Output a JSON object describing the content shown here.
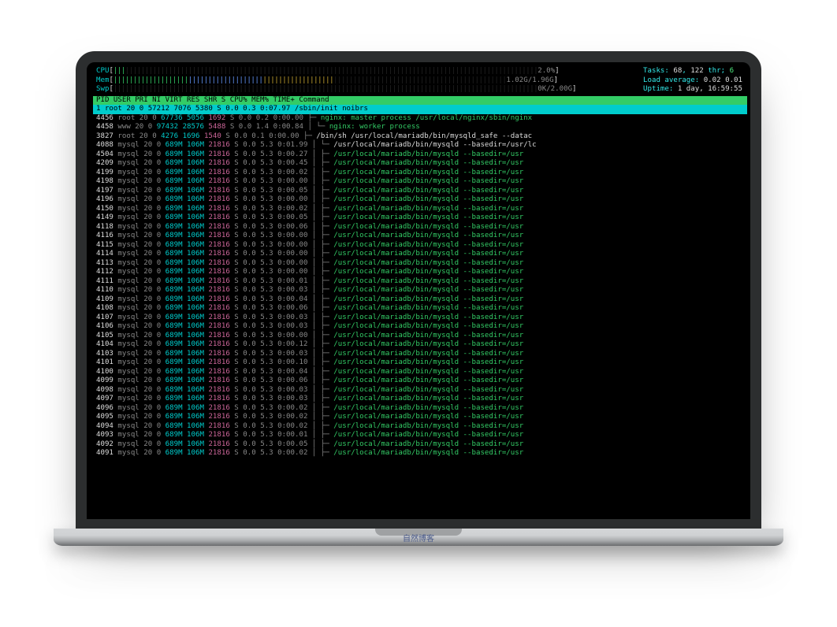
{
  "cpu": {
    "label": "CPU",
    "pct": "2.0%"
  },
  "mem": {
    "label": "Mem",
    "used": "1.02G",
    "total": "1.96G"
  },
  "swp": {
    "label": "Swp",
    "used": "0K",
    "total": "2.00G"
  },
  "info": {
    "tasks_lbl": "Tasks:",
    "tasks": "68",
    "tasks_thr": "122",
    "thr_lbl": "thr;",
    "running": "6",
    "load_lbl": "Load average:",
    "load1": "0.02",
    "load2": "0.01",
    "uptime_lbl": "Uptime:",
    "uptime": "1 day, 16:59:55"
  },
  "columns": {
    "pid": "PID",
    "user": "USER",
    "pri": "PRI",
    "ni": "NI",
    "virt": "VIRT",
    "res": "RES",
    "shr": "SHR",
    "s": "S",
    "cpu": "CPU%",
    "mem": "MEM%",
    "time": "TIME+",
    "cmd": "Command"
  },
  "selected": {
    "pid": "1",
    "user": "root",
    "pri": "20",
    "ni": "0",
    "virt": "57212",
    "res": "7076",
    "shr": "5380",
    "s": "S",
    "cpu": "0.0",
    "mem": "0.3",
    "time": "0:07.97",
    "cmd": "/sbin/init noibrs"
  },
  "rows": [
    {
      "pid": "4456",
      "user": "root",
      "pri": "20",
      "ni": "0",
      "virt": "67736",
      "res": "5056",
      "shr": "1692",
      "s": "S",
      "cpu": "0.0",
      "mem": "0.2",
      "time": "0:00.00",
      "tree": "├─ ",
      "cmd": "nginx: master process /usr/local/nginx/sbin/nginx",
      "cmdcls": "c-green"
    },
    {
      "pid": "4458",
      "user": "www",
      "pri": "20",
      "ni": "0",
      "virt": "97432",
      "res": "28576",
      "shr": "5488",
      "s": "S",
      "cpu": "0.0",
      "mem": "1.4",
      "time": "0:00.84",
      "tree": "│  └─ ",
      "cmd": "nginx: worker process",
      "cmdcls": "c-green"
    },
    {
      "pid": "3827",
      "user": "root",
      "pri": "20",
      "ni": "0",
      "virt": "4276",
      "res": "1696",
      "shr": "1540",
      "s": "S",
      "cpu": "0.0",
      "mem": "0.1",
      "time": "0:00.00",
      "tree": "├─ ",
      "cmd": "/bin/sh /usr/local/mariadb/bin/mysqld_safe --datac",
      "cmdcls": "c-white"
    },
    {
      "pid": "4088",
      "user": "mysql",
      "pri": "20",
      "ni": "0",
      "virt": "689M",
      "res": "106M",
      "shr": "21816",
      "s": "S",
      "cpu": "0.0",
      "mem": "5.3",
      "time": "0:01.99",
      "tree": "│  └─ ",
      "cmd": "/usr/local/mariadb/bin/mysqld --basedir=/usr/lc",
      "cmdcls": "c-white"
    },
    {
      "pid": "4504",
      "user": "mysql",
      "pri": "20",
      "ni": "0",
      "virt": "689M",
      "res": "106M",
      "shr": "21816",
      "s": "S",
      "cpu": "0.0",
      "mem": "5.3",
      "time": "0:00.27",
      "tree": "│     ├─ ",
      "cmd": "/usr/local/mariadb/bin/mysqld --basedir=/usr",
      "cmdcls": "c-green"
    },
    {
      "pid": "4209",
      "user": "mysql",
      "pri": "20",
      "ni": "0",
      "virt": "689M",
      "res": "106M",
      "shr": "21816",
      "s": "S",
      "cpu": "0.0",
      "mem": "5.3",
      "time": "0:00.45",
      "tree": "│     ├─ ",
      "cmd": "/usr/local/mariadb/bin/mysqld --basedir=/usr",
      "cmdcls": "c-green"
    },
    {
      "pid": "4199",
      "user": "mysql",
      "pri": "20",
      "ni": "0",
      "virt": "689M",
      "res": "106M",
      "shr": "21816",
      "s": "S",
      "cpu": "0.0",
      "mem": "5.3",
      "time": "0:00.02",
      "tree": "│     ├─ ",
      "cmd": "/usr/local/mariadb/bin/mysqld --basedir=/usr",
      "cmdcls": "c-green"
    },
    {
      "pid": "4198",
      "user": "mysql",
      "pri": "20",
      "ni": "0",
      "virt": "689M",
      "res": "106M",
      "shr": "21816",
      "s": "S",
      "cpu": "0.0",
      "mem": "5.3",
      "time": "0:00.00",
      "tree": "│     ├─ ",
      "cmd": "/usr/local/mariadb/bin/mysqld --basedir=/usr",
      "cmdcls": "c-green"
    },
    {
      "pid": "4197",
      "user": "mysql",
      "pri": "20",
      "ni": "0",
      "virt": "689M",
      "res": "106M",
      "shr": "21816",
      "s": "S",
      "cpu": "0.0",
      "mem": "5.3",
      "time": "0:00.05",
      "tree": "│     ├─ ",
      "cmd": "/usr/local/mariadb/bin/mysqld --basedir=/usr",
      "cmdcls": "c-green"
    },
    {
      "pid": "4196",
      "user": "mysql",
      "pri": "20",
      "ni": "0",
      "virt": "689M",
      "res": "106M",
      "shr": "21816",
      "s": "S",
      "cpu": "0.0",
      "mem": "5.3",
      "time": "0:00.00",
      "tree": "│     ├─ ",
      "cmd": "/usr/local/mariadb/bin/mysqld --basedir=/usr",
      "cmdcls": "c-green"
    },
    {
      "pid": "4150",
      "user": "mysql",
      "pri": "20",
      "ni": "0",
      "virt": "689M",
      "res": "106M",
      "shr": "21816",
      "s": "S",
      "cpu": "0.0",
      "mem": "5.3",
      "time": "0:00.02",
      "tree": "│     ├─ ",
      "cmd": "/usr/local/mariadb/bin/mysqld --basedir=/usr",
      "cmdcls": "c-green"
    },
    {
      "pid": "4149",
      "user": "mysql",
      "pri": "20",
      "ni": "0",
      "virt": "689M",
      "res": "106M",
      "shr": "21816",
      "s": "S",
      "cpu": "0.0",
      "mem": "5.3",
      "time": "0:00.05",
      "tree": "│     ├─ ",
      "cmd": "/usr/local/mariadb/bin/mysqld --basedir=/usr",
      "cmdcls": "c-green"
    },
    {
      "pid": "4118",
      "user": "mysql",
      "pri": "20",
      "ni": "0",
      "virt": "689M",
      "res": "106M",
      "shr": "21816",
      "s": "S",
      "cpu": "0.0",
      "mem": "5.3",
      "time": "0:00.06",
      "tree": "│     ├─ ",
      "cmd": "/usr/local/mariadb/bin/mysqld --basedir=/usr",
      "cmdcls": "c-green"
    },
    {
      "pid": "4116",
      "user": "mysql",
      "pri": "20",
      "ni": "0",
      "virt": "689M",
      "res": "106M",
      "shr": "21816",
      "s": "S",
      "cpu": "0.0",
      "mem": "5.3",
      "time": "0:00.00",
      "tree": "│     ├─ ",
      "cmd": "/usr/local/mariadb/bin/mysqld --basedir=/usr",
      "cmdcls": "c-green"
    },
    {
      "pid": "4115",
      "user": "mysql",
      "pri": "20",
      "ni": "0",
      "virt": "689M",
      "res": "106M",
      "shr": "21816",
      "s": "S",
      "cpu": "0.0",
      "mem": "5.3",
      "time": "0:00.00",
      "tree": "│     ├─ ",
      "cmd": "/usr/local/mariadb/bin/mysqld --basedir=/usr",
      "cmdcls": "c-green"
    },
    {
      "pid": "4114",
      "user": "mysql",
      "pri": "20",
      "ni": "0",
      "virt": "689M",
      "res": "106M",
      "shr": "21816",
      "s": "S",
      "cpu": "0.0",
      "mem": "5.3",
      "time": "0:00.00",
      "tree": "│     ├─ ",
      "cmd": "/usr/local/mariadb/bin/mysqld --basedir=/usr",
      "cmdcls": "c-green"
    },
    {
      "pid": "4113",
      "user": "mysql",
      "pri": "20",
      "ni": "0",
      "virt": "689M",
      "res": "106M",
      "shr": "21816",
      "s": "S",
      "cpu": "0.0",
      "mem": "5.3",
      "time": "0:00.00",
      "tree": "│     ├─ ",
      "cmd": "/usr/local/mariadb/bin/mysqld --basedir=/usr",
      "cmdcls": "c-green"
    },
    {
      "pid": "4112",
      "user": "mysql",
      "pri": "20",
      "ni": "0",
      "virt": "689M",
      "res": "106M",
      "shr": "21816",
      "s": "S",
      "cpu": "0.0",
      "mem": "5.3",
      "time": "0:00.00",
      "tree": "│     ├─ ",
      "cmd": "/usr/local/mariadb/bin/mysqld --basedir=/usr",
      "cmdcls": "c-green"
    },
    {
      "pid": "4111",
      "user": "mysql",
      "pri": "20",
      "ni": "0",
      "virt": "689M",
      "res": "106M",
      "shr": "21816",
      "s": "S",
      "cpu": "0.0",
      "mem": "5.3",
      "time": "0:00.01",
      "tree": "│     ├─ ",
      "cmd": "/usr/local/mariadb/bin/mysqld --basedir=/usr",
      "cmdcls": "c-green"
    },
    {
      "pid": "4110",
      "user": "mysql",
      "pri": "20",
      "ni": "0",
      "virt": "689M",
      "res": "106M",
      "shr": "21816",
      "s": "S",
      "cpu": "0.0",
      "mem": "5.3",
      "time": "0:00.03",
      "tree": "│     ├─ ",
      "cmd": "/usr/local/mariadb/bin/mysqld --basedir=/usr",
      "cmdcls": "c-green"
    },
    {
      "pid": "4109",
      "user": "mysql",
      "pri": "20",
      "ni": "0",
      "virt": "689M",
      "res": "106M",
      "shr": "21816",
      "s": "S",
      "cpu": "0.0",
      "mem": "5.3",
      "time": "0:00.04",
      "tree": "│     ├─ ",
      "cmd": "/usr/local/mariadb/bin/mysqld --basedir=/usr",
      "cmdcls": "c-green"
    },
    {
      "pid": "4108",
      "user": "mysql",
      "pri": "20",
      "ni": "0",
      "virt": "689M",
      "res": "106M",
      "shr": "21816",
      "s": "S",
      "cpu": "0.0",
      "mem": "5.3",
      "time": "0:00.06",
      "tree": "│     ├─ ",
      "cmd": "/usr/local/mariadb/bin/mysqld --basedir=/usr",
      "cmdcls": "c-green"
    },
    {
      "pid": "4107",
      "user": "mysql",
      "pri": "20",
      "ni": "0",
      "virt": "689M",
      "res": "106M",
      "shr": "21816",
      "s": "S",
      "cpu": "0.0",
      "mem": "5.3",
      "time": "0:00.03",
      "tree": "│     ├─ ",
      "cmd": "/usr/local/mariadb/bin/mysqld --basedir=/usr",
      "cmdcls": "c-green"
    },
    {
      "pid": "4106",
      "user": "mysql",
      "pri": "20",
      "ni": "0",
      "virt": "689M",
      "res": "106M",
      "shr": "21816",
      "s": "S",
      "cpu": "0.0",
      "mem": "5.3",
      "time": "0:00.03",
      "tree": "│     ├─ ",
      "cmd": "/usr/local/mariadb/bin/mysqld --basedir=/usr",
      "cmdcls": "c-green"
    },
    {
      "pid": "4105",
      "user": "mysql",
      "pri": "20",
      "ni": "0",
      "virt": "689M",
      "res": "106M",
      "shr": "21816",
      "s": "S",
      "cpu": "0.0",
      "mem": "5.3",
      "time": "0:00.00",
      "tree": "│     ├─ ",
      "cmd": "/usr/local/mariadb/bin/mysqld --basedir=/usr",
      "cmdcls": "c-green"
    },
    {
      "pid": "4104",
      "user": "mysql",
      "pri": "20",
      "ni": "0",
      "virt": "689M",
      "res": "106M",
      "shr": "21816",
      "s": "S",
      "cpu": "0.0",
      "mem": "5.3",
      "time": "0:00.12",
      "tree": "│     ├─ ",
      "cmd": "/usr/local/mariadb/bin/mysqld --basedir=/usr",
      "cmdcls": "c-green"
    },
    {
      "pid": "4103",
      "user": "mysql",
      "pri": "20",
      "ni": "0",
      "virt": "689M",
      "res": "106M",
      "shr": "21816",
      "s": "S",
      "cpu": "0.0",
      "mem": "5.3",
      "time": "0:00.03",
      "tree": "│     ├─ ",
      "cmd": "/usr/local/mariadb/bin/mysqld --basedir=/usr",
      "cmdcls": "c-green"
    },
    {
      "pid": "4101",
      "user": "mysql",
      "pri": "20",
      "ni": "0",
      "virt": "689M",
      "res": "106M",
      "shr": "21816",
      "s": "S",
      "cpu": "0.0",
      "mem": "5.3",
      "time": "0:00.10",
      "tree": "│     ├─ ",
      "cmd": "/usr/local/mariadb/bin/mysqld --basedir=/usr",
      "cmdcls": "c-green"
    },
    {
      "pid": "4100",
      "user": "mysql",
      "pri": "20",
      "ni": "0",
      "virt": "689M",
      "res": "106M",
      "shr": "21816",
      "s": "S",
      "cpu": "0.0",
      "mem": "5.3",
      "time": "0:00.04",
      "tree": "│     ├─ ",
      "cmd": "/usr/local/mariadb/bin/mysqld --basedir=/usr",
      "cmdcls": "c-green"
    },
    {
      "pid": "4099",
      "user": "mysql",
      "pri": "20",
      "ni": "0",
      "virt": "689M",
      "res": "106M",
      "shr": "21816",
      "s": "S",
      "cpu": "0.0",
      "mem": "5.3",
      "time": "0:00.06",
      "tree": "│     ├─ ",
      "cmd": "/usr/local/mariadb/bin/mysqld --basedir=/usr",
      "cmdcls": "c-green"
    },
    {
      "pid": "4098",
      "user": "mysql",
      "pri": "20",
      "ni": "0",
      "virt": "689M",
      "res": "106M",
      "shr": "21816",
      "s": "S",
      "cpu": "0.0",
      "mem": "5.3",
      "time": "0:00.03",
      "tree": "│     ├─ ",
      "cmd": "/usr/local/mariadb/bin/mysqld --basedir=/usr",
      "cmdcls": "c-green"
    },
    {
      "pid": "4097",
      "user": "mysql",
      "pri": "20",
      "ni": "0",
      "virt": "689M",
      "res": "106M",
      "shr": "21816",
      "s": "S",
      "cpu": "0.0",
      "mem": "5.3",
      "time": "0:00.03",
      "tree": "│     ├─ ",
      "cmd": "/usr/local/mariadb/bin/mysqld --basedir=/usr",
      "cmdcls": "c-green"
    },
    {
      "pid": "4096",
      "user": "mysql",
      "pri": "20",
      "ni": "0",
      "virt": "689M",
      "res": "106M",
      "shr": "21816",
      "s": "S",
      "cpu": "0.0",
      "mem": "5.3",
      "time": "0:00.02",
      "tree": "│     ├─ ",
      "cmd": "/usr/local/mariadb/bin/mysqld --basedir=/usr",
      "cmdcls": "c-green"
    },
    {
      "pid": "4095",
      "user": "mysql",
      "pri": "20",
      "ni": "0",
      "virt": "689M",
      "res": "106M",
      "shr": "21816",
      "s": "S",
      "cpu": "0.0",
      "mem": "5.3",
      "time": "0:00.02",
      "tree": "│     ├─ ",
      "cmd": "/usr/local/mariadb/bin/mysqld --basedir=/usr",
      "cmdcls": "c-green"
    },
    {
      "pid": "4094",
      "user": "mysql",
      "pri": "20",
      "ni": "0",
      "virt": "689M",
      "res": "106M",
      "shr": "21816",
      "s": "S",
      "cpu": "0.0",
      "mem": "5.3",
      "time": "0:00.02",
      "tree": "│     ├─ ",
      "cmd": "/usr/local/mariadb/bin/mysqld --basedir=/usr",
      "cmdcls": "c-green"
    },
    {
      "pid": "4093",
      "user": "mysql",
      "pri": "20",
      "ni": "0",
      "virt": "689M",
      "res": "106M",
      "shr": "21816",
      "s": "S",
      "cpu": "0.0",
      "mem": "5.3",
      "time": "0:00.01",
      "tree": "│     ├─ ",
      "cmd": "/usr/local/mariadb/bin/mysqld --basedir=/usr",
      "cmdcls": "c-green"
    },
    {
      "pid": "4092",
      "user": "mysql",
      "pri": "20",
      "ni": "0",
      "virt": "689M",
      "res": "106M",
      "shr": "21816",
      "s": "S",
      "cpu": "0.0",
      "mem": "5.3",
      "time": "0:00.05",
      "tree": "│     ├─ ",
      "cmd": "/usr/local/mariadb/bin/mysqld --basedir=/usr",
      "cmdcls": "c-green"
    },
    {
      "pid": "4091",
      "user": "mysql",
      "pri": "20",
      "ni": "0",
      "virt": "689M",
      "res": "106M",
      "shr": "21816",
      "s": "S",
      "cpu": "0.0",
      "mem": "5.3",
      "time": "0:00.02",
      "tree": "│     ├─ ",
      "cmd": "/usr/local/mariadb/bin/mysqld --basedir=/usr",
      "cmdcls": "c-green"
    }
  ],
  "watermark": "自然博客"
}
